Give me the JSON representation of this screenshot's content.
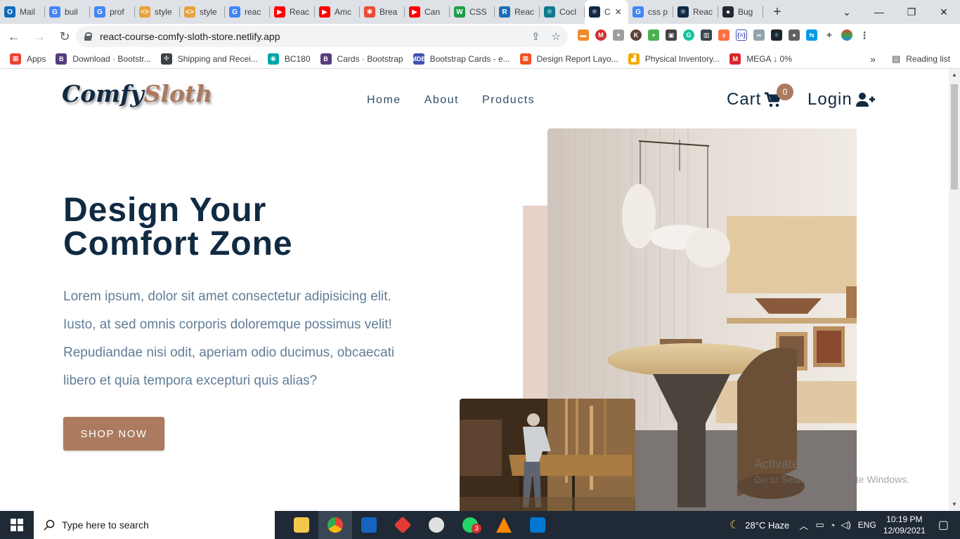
{
  "browser": {
    "tabs": [
      {
        "label": "Mail",
        "color": "#0f6cbd",
        "glyph": "O"
      },
      {
        "label": "buil",
        "color": "#4285f4",
        "glyph": "G"
      },
      {
        "label": "prof",
        "color": "#4285f4",
        "glyph": "G"
      },
      {
        "label": "style",
        "color": "#e8a33d",
        "glyph": "<>"
      },
      {
        "label": "style",
        "color": "#e8a33d",
        "glyph": "<>"
      },
      {
        "label": "reac",
        "color": "#4285f4",
        "glyph": "G"
      },
      {
        "label": "Reac",
        "color": "#ff0000",
        "glyph": "▶"
      },
      {
        "label": "Amc",
        "color": "#ff0000",
        "glyph": "▶"
      },
      {
        "label": "Brea",
        "color": "#e94b35",
        "glyph": "✱"
      },
      {
        "label": "Can",
        "color": "#ff0000",
        "glyph": "▶"
      },
      {
        "label": "CSS",
        "color": "#1e9e4a",
        "glyph": "W"
      },
      {
        "label": "Reac",
        "color": "#1b6fb8",
        "glyph": "R"
      },
      {
        "label": "Cocl",
        "color": "#0f7a8c",
        "glyph": "⚛"
      },
      {
        "label": "C",
        "color": "#0f2a42",
        "glyph": "⚛",
        "active": true
      },
      {
        "label": "css p",
        "color": "#4285f4",
        "glyph": "G"
      },
      {
        "label": "Reac",
        "color": "#0f2a42",
        "glyph": "⚛"
      },
      {
        "label": "Bug",
        "color": "#24292f",
        "glyph": "●"
      }
    ],
    "url": "react-course-comfy-sloth-store.netlify.app",
    "bookmarks": [
      {
        "label": "Apps",
        "color": "#ea4335",
        "glyph": "▦"
      },
      {
        "label": "Download · Bootstr...",
        "color": "#563d7c",
        "glyph": "B"
      },
      {
        "label": "Shipping and Recei...",
        "color": "#3c4043",
        "glyph": "✣"
      },
      {
        "label": "BC180",
        "color": "#00a6a6",
        "glyph": "◉"
      },
      {
        "label": "Cards · Bootstrap",
        "color": "#563d7c",
        "glyph": "B"
      },
      {
        "label": "Bootstrap Cards - e...",
        "color": "#3f51b5",
        "glyph": "MDB"
      },
      {
        "label": "Design Report Layo...",
        "color": "#f25022",
        "glyph": "▦"
      },
      {
        "label": "Physical Inventory...",
        "color": "#f2a900",
        "glyph": "▟"
      },
      {
        "label": "MEGA ↓ 0%",
        "color": "#d9272e",
        "glyph": "M"
      }
    ],
    "more_bookmarks": "»",
    "reading_list": "Reading list"
  },
  "site": {
    "logo_main": "Comfy",
    "logo_accent": "Sloth",
    "nav": [
      "Home",
      "About",
      "Products"
    ],
    "cart_label": "Cart",
    "cart_count": "0",
    "login_label": "Login",
    "hero_title_line1": "Design Your",
    "hero_title_line2": "Comfort Zone",
    "hero_text_lines": [
      "Lorem ipsum, dolor sit amet consectetur adipisicing elit.",
      "Iusto, at sed omnis corporis doloremque possimus velit!",
      "Repudiandae nisi odit, aperiam odio ducimus, obcaecati",
      "libero et quia tempora excepturi quis alias?"
    ],
    "shop_button": "SHOP NOW",
    "colors": {
      "primary": "#ab7a5f",
      "dark": "#102a42",
      "text": "#617d98",
      "accent_bg": "#e8d3c9"
    }
  },
  "windows": {
    "watermark_line1": "Activate Windows",
    "watermark_line2": "Go to Settings to activate Windows.",
    "search_placeholder": "Type here to search",
    "weather": "28°C  Haze",
    "language": "ENG",
    "time": "10:19 PM",
    "date": "12/09/2021",
    "whatsapp_badge": "3"
  }
}
